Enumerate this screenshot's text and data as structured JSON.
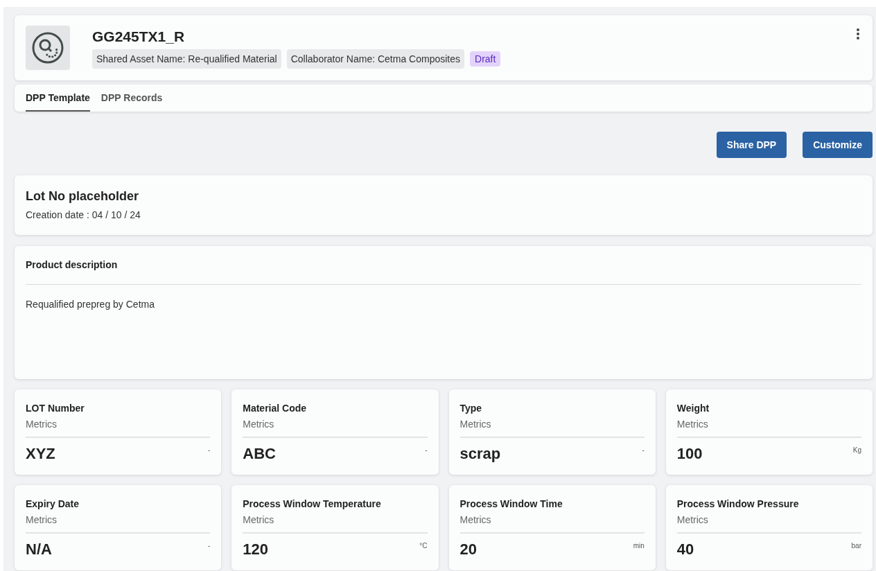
{
  "header": {
    "title": "GG245TX1_R",
    "chips": [
      {
        "kind": "info",
        "label": "Shared Asset Name: Re-qualified Material"
      },
      {
        "kind": "info",
        "label": "Collaborator Name: Cetma Composites"
      },
      {
        "kind": "status",
        "label": "Draft"
      }
    ]
  },
  "tabs": [
    {
      "label": "DPP Template",
      "selected": true
    },
    {
      "label": "DPP Records",
      "selected": false
    }
  ],
  "actions": [
    "Share DPP",
    "Customize"
  ],
  "lot": {
    "title": "Lot No placeholder",
    "creation_date": "Creation date : 04 / 10 / 24"
  },
  "description": {
    "title": "Product description",
    "text": "Requalified prepreg by Cetma"
  },
  "metrics": [
    {
      "title": "LOT Number",
      "subtitle": "Metrics",
      "value": "XYZ",
      "unit": "-"
    },
    {
      "title": "Material Code",
      "subtitle": "Metrics",
      "value": "ABC",
      "unit": "-"
    },
    {
      "title": "Type",
      "subtitle": "Metrics",
      "value": "scrap",
      "unit": "-"
    },
    {
      "title": "Weight",
      "subtitle": "Metrics",
      "value": "100",
      "unit": "Kg"
    },
    {
      "title": "Expiry Date",
      "subtitle": "Metrics",
      "value": "N/A",
      "unit": "-"
    },
    {
      "title": "Process Window Temperature",
      "subtitle": "Metrics",
      "value": "120",
      "unit": "°C"
    },
    {
      "title": "Process Window Time",
      "subtitle": "Metrics",
      "value": "20",
      "unit": "min"
    },
    {
      "title": "Process Window Pressure",
      "subtitle": "Metrics",
      "value": "40",
      "unit": "bar"
    }
  ]
}
